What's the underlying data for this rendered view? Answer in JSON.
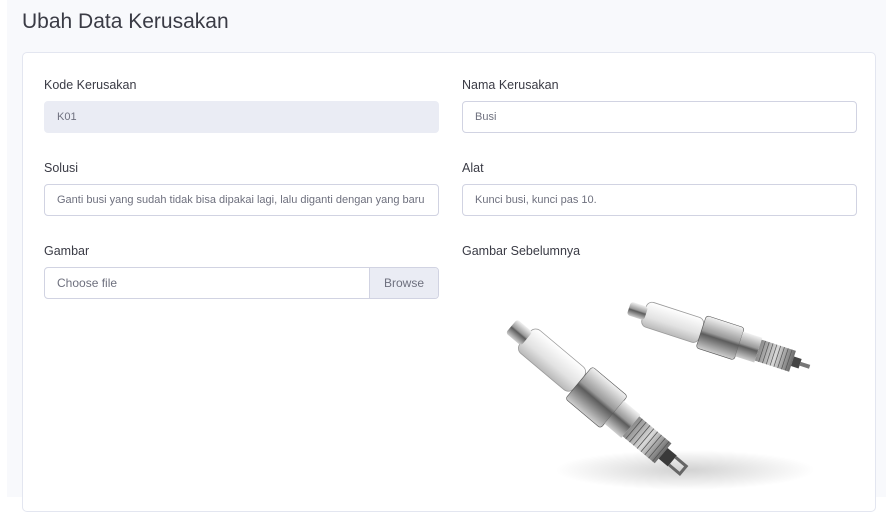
{
  "page": {
    "title": "Ubah Data Kerusakan"
  },
  "form": {
    "kode": {
      "label": "Kode Kerusakan",
      "value": "K01"
    },
    "nama": {
      "label": "Nama Kerusakan",
      "value": "Busi"
    },
    "solusi": {
      "label": "Solusi",
      "value": "Ganti busi yang sudah tidak bisa dipakai lagi, lalu diganti dengan yang baru"
    },
    "alat": {
      "label": "Alat",
      "value": "Kunci busi, kunci pas 10."
    },
    "gambar": {
      "label": "Gambar",
      "placeholder": "Choose file",
      "browse_label": "Browse"
    },
    "gambar_sebelumnya": {
      "label": "Gambar Sebelumnya",
      "image": "spark-plugs-image"
    }
  },
  "colors": {
    "background": "#f8f9fc",
    "text": "#3a3b45",
    "input_border": "#d1d3e2",
    "readonly_bg": "#eaecf4"
  }
}
